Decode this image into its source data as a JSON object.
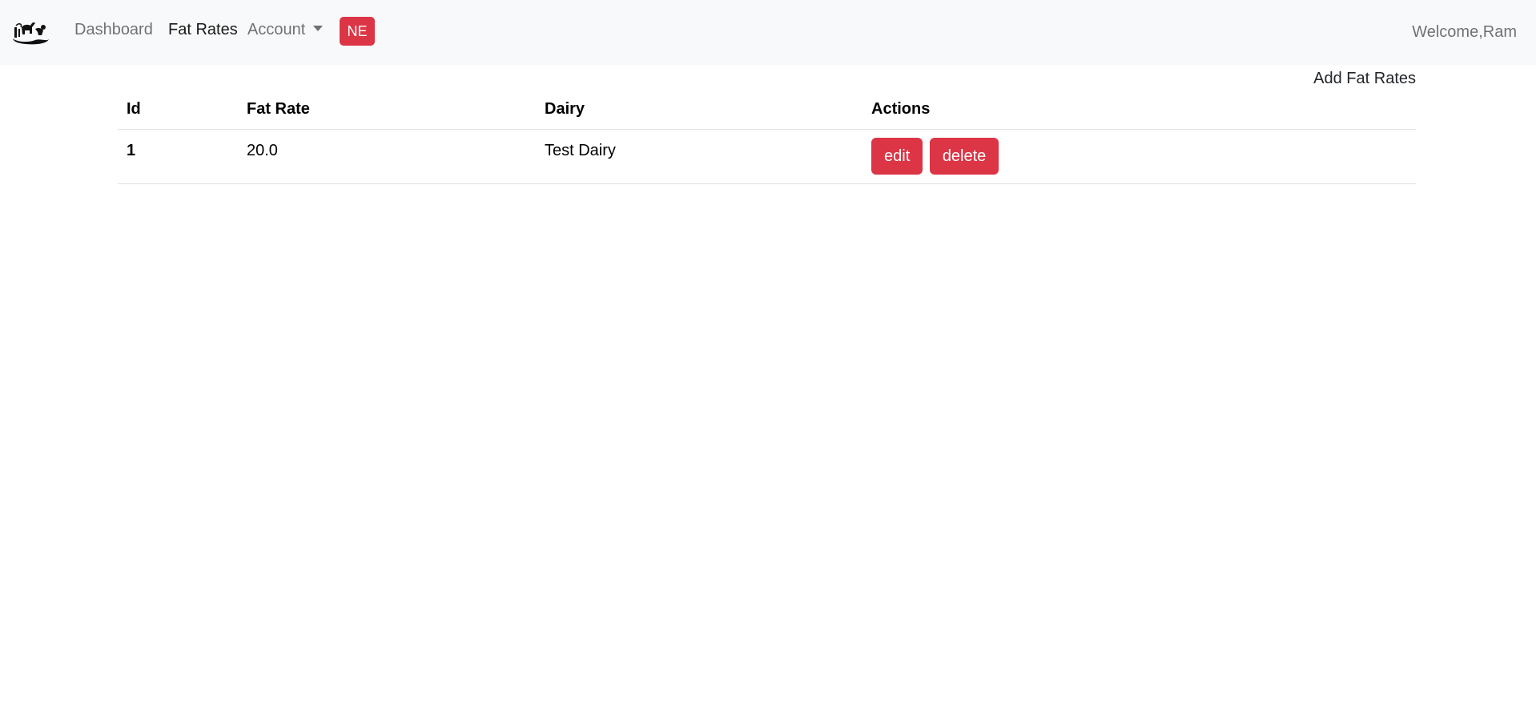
{
  "navbar": {
    "logo_icon": "dairy-cow-logo-icon",
    "links": [
      {
        "label": "Dashboard",
        "active": false
      },
      {
        "label": "Fat Rates",
        "active": true
      },
      {
        "label": "Account",
        "active": false,
        "dropdown": true
      }
    ],
    "badge": "NE",
    "welcome": "Welcome,Ram",
    "colors": {
      "background": "#f8f9fa",
      "badge": "#dc3545"
    }
  },
  "page": {
    "add_link": "Add Fat Rates"
  },
  "table": {
    "headers": [
      "Id",
      "Fat Rate",
      "Dairy",
      "Actions"
    ],
    "rows": [
      {
        "id": "1",
        "fat_rate": "20.0",
        "dairy": "Test Dairy",
        "edit_label": "edit",
        "delete_label": "delete"
      }
    ],
    "colors": {
      "button": "#dc3545",
      "border": "#dee2e6"
    }
  }
}
